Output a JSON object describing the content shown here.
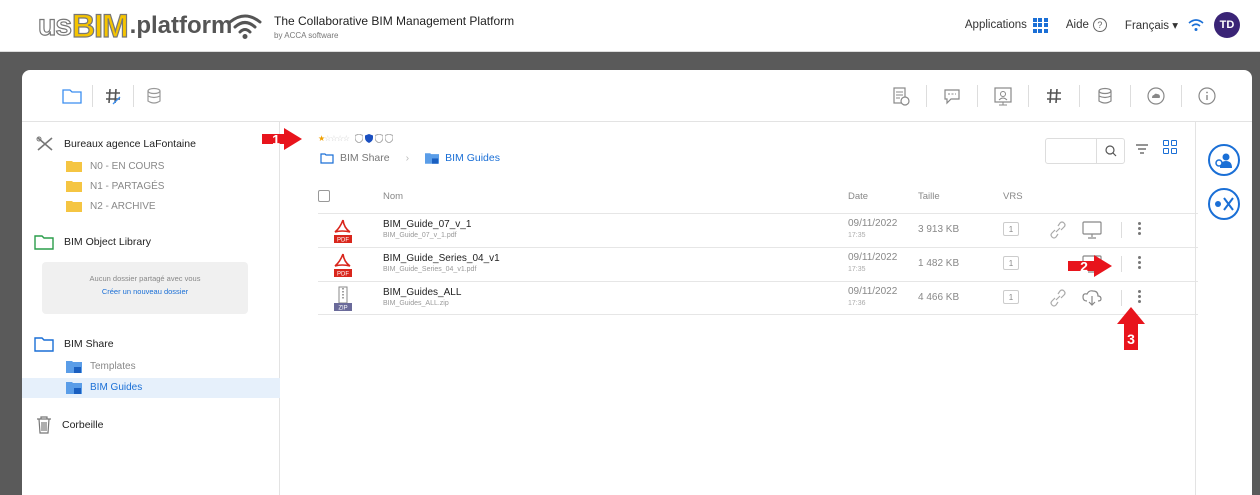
{
  "header": {
    "logo_us": "us",
    "logo_bim": "BIM",
    "logo_platform": ".platform",
    "tagline": "The Collaborative BIM Management Platform",
    "byline": "by ACCA software",
    "applications": "Applications",
    "aide": "Aide",
    "language": "Français ▾",
    "avatar_initials": "TD"
  },
  "sidebar": {
    "section1": "Bureaux agence LaFontaine",
    "folders1": [
      "N0 - EN COURS",
      "N1 - PARTAGÉS",
      "N2 - ARCHIVE"
    ],
    "section2": "BIM Object Library",
    "empty_text": "Aucun dossier partagé avec vous",
    "empty_link": "Créer un nouveau dossier",
    "section3": "BIM Share",
    "folders3": [
      "Templates",
      "BIM Guides"
    ],
    "section4": "Corbeille"
  },
  "content": {
    "crumb1": "BIM Share",
    "crumb2": "BIM Guides",
    "col_name": "Nom",
    "col_date": "Date",
    "col_size": "Taille",
    "col_vrs": "VRS",
    "rows": [
      {
        "name": "BIM_Guide_07_v_1",
        "file": "BIM_Guide_07_v_1.pdf",
        "date": "09/11/2022",
        "time": "17:35",
        "size": "3 913 KB",
        "vrs": "1",
        "type": "PDF"
      },
      {
        "name": "BIM_Guide_Series_04_v1",
        "file": "BIM_Guide_Series_04_v1.pdf",
        "date": "09/11/2022",
        "time": "17:35",
        "size": "1 482 KB",
        "vrs": "1",
        "type": "PDF"
      },
      {
        "name": "BIM_Guides_ALL",
        "file": "BIM_Guides_ALL.zip",
        "date": "09/11/2022",
        "time": "17:36",
        "size": "4 466 KB",
        "vrs": "1",
        "type": "ZIP"
      }
    ]
  },
  "callouts": [
    "1",
    "2",
    "3"
  ],
  "colors": {
    "accent": "#1a6fd6",
    "folder_yellow": "#f5c542",
    "callout_red": "#e8141c"
  }
}
